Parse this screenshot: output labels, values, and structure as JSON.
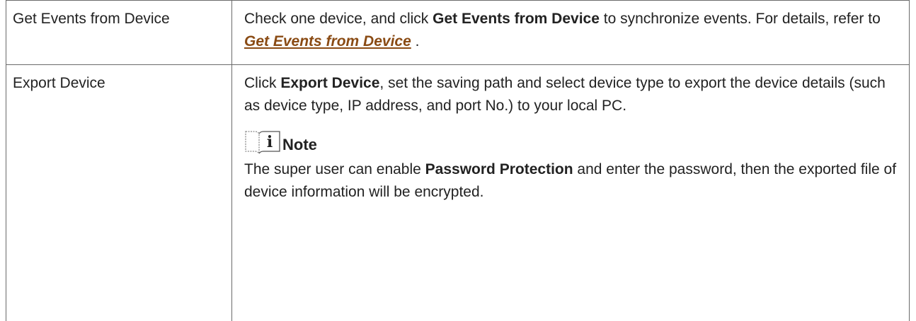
{
  "table": {
    "rows": [
      {
        "label": "Get Events from Device",
        "desc_pre": "Check one device, and click ",
        "desc_bold": "Get Events from Device",
        "desc_mid": " to synchronize events. For details, refer to ",
        "desc_link": "Get Events from Device",
        "desc_post": " ."
      },
      {
        "label": "Export Device",
        "desc_pre": "Click ",
        "desc_bold": "Export Device",
        "desc_post": ", set the saving path and select device type to export the device details (such as device type, IP address, and port No.) to your local PC.",
        "note": {
          "title": "Note",
          "icon": "note-book-icon",
          "body_pre": "The super user can enable ",
          "body_bold": "Password Protection",
          "body_post": " and enter the password, then the exported file of device information will be encrypted."
        }
      }
    ]
  },
  "colors": {
    "text": "#222222",
    "border": "#6a6a6a",
    "link": "#8a4b14"
  }
}
